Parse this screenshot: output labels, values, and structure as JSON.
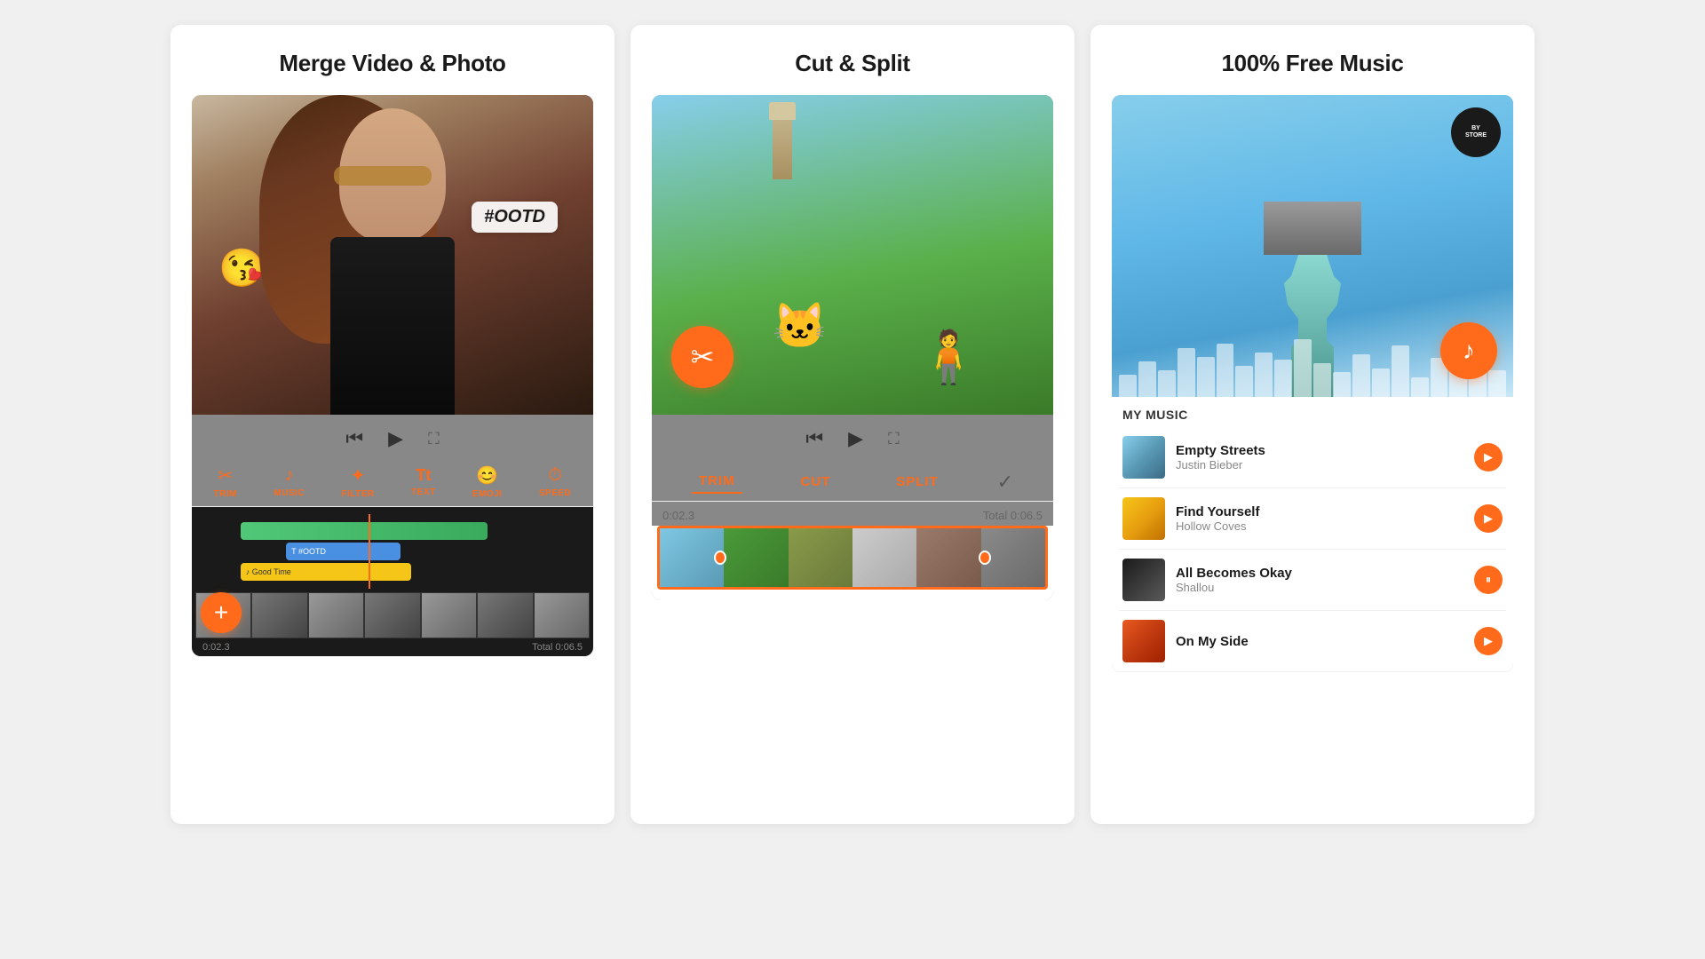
{
  "panel1": {
    "title": "Merge Video & Photo",
    "hashtag": "#OOTD",
    "emoji": "😘",
    "tools": [
      {
        "id": "trim",
        "icon": "✂",
        "label": "TRIM"
      },
      {
        "id": "music",
        "icon": "♪",
        "label": "MUSIC"
      },
      {
        "id": "filter",
        "icon": "⊕",
        "label": "FILTER"
      },
      {
        "id": "text",
        "icon": "Tt",
        "label": "TEXT"
      },
      {
        "id": "emoji",
        "icon": "😊",
        "label": "EMOJI"
      },
      {
        "id": "speed",
        "icon": "⏱",
        "label": "SPEED"
      }
    ],
    "timeline": {
      "text_track": "T #OOTD",
      "music_track": "♪ Good Time",
      "time_current": "0:02.3",
      "time_total": "Total 0:06.5"
    },
    "add_button": "+"
  },
  "panel2": {
    "title": "Cut & Split",
    "tabs": [
      "TRIM",
      "CUT",
      "SPLIT"
    ],
    "time_current": "0:02.3",
    "time_total": "Total 0:06.5"
  },
  "panel3": {
    "title": "100% Free Music",
    "music_badge": {
      "line1": "BY",
      "line2": "STORE"
    },
    "section_title": "MY MUSIC",
    "songs": [
      {
        "id": "song1",
        "title": "Empty Streets",
        "artist": "Justin Bieber"
      },
      {
        "id": "song2",
        "title": "Find Yourself",
        "artist": "Hollow Coves"
      },
      {
        "id": "song3",
        "title": "All Becomes Okay",
        "artist": "Shallou"
      },
      {
        "id": "song4",
        "title": "On My Side",
        "artist": ""
      }
    ]
  }
}
